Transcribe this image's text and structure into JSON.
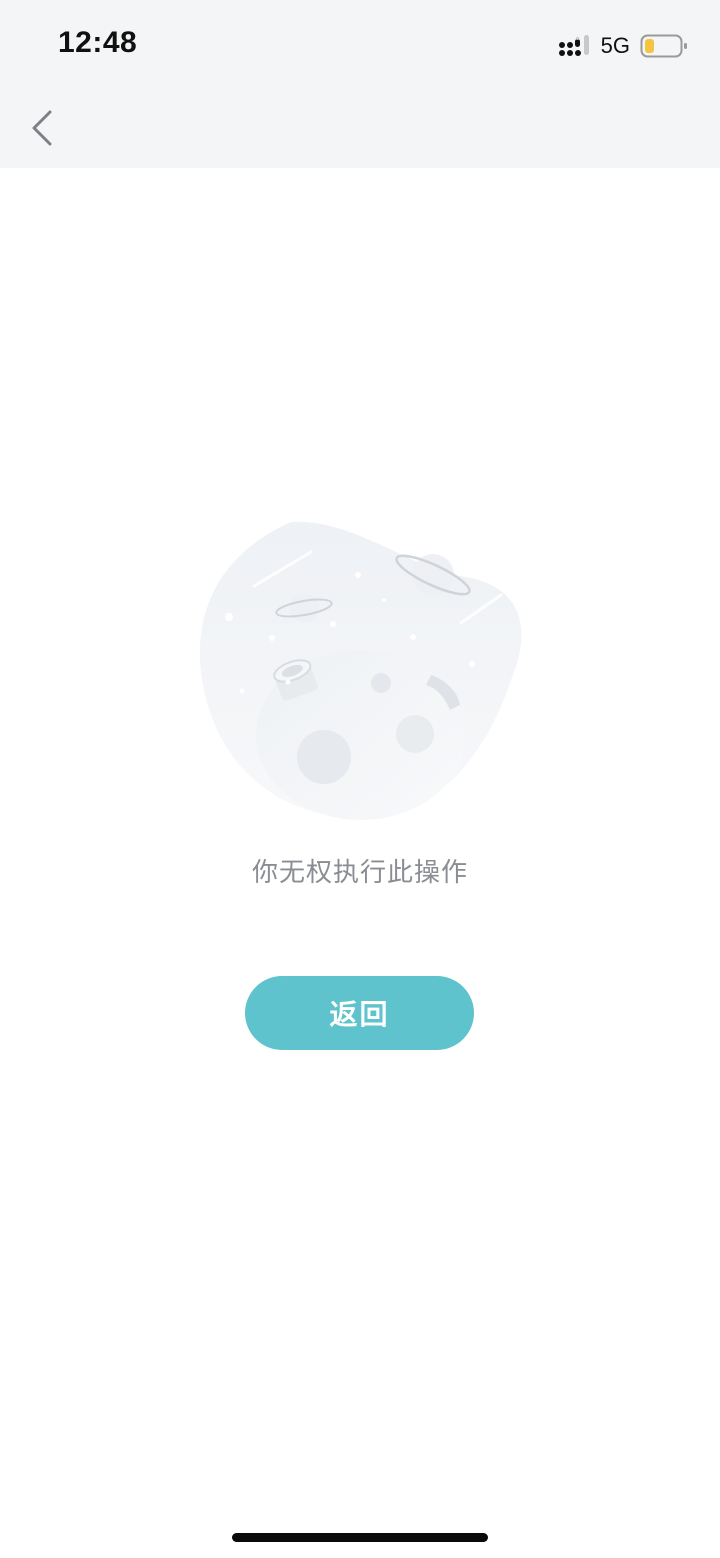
{
  "status_bar": {
    "time": "12:48",
    "network": "5G",
    "signal_icon": "cellular-signal-icon",
    "battery_icon": "battery-low-icon",
    "battery_color": "#f5c542"
  },
  "nav": {
    "back_icon": "chevron-left-icon"
  },
  "empty_state": {
    "illustration": "moon-planets-illustration",
    "message": "你无权执行此操作"
  },
  "actions": {
    "return_label": "返回",
    "return_color": "#5ec3cc"
  }
}
